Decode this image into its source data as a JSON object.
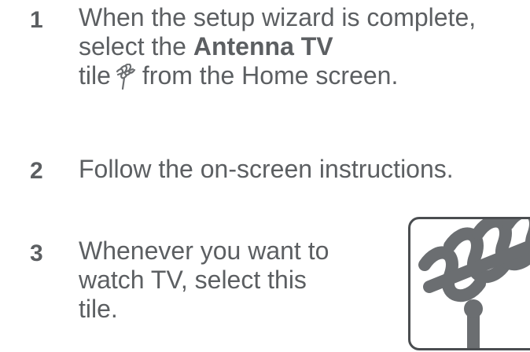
{
  "steps": [
    {
      "number": "1",
      "line1": "When the setup wizard is complete,",
      "line2_prefix": "select the ",
      "line2_bold": "Antenna TV",
      "line3_prefix": "tile",
      "line3_suffix": "from the Home screen."
    },
    {
      "number": "2",
      "line1": "Follow the on-screen instructions."
    },
    {
      "number": "3",
      "line1": "Whenever you want to",
      "line2": "watch TV, select this",
      "line3": "tile."
    }
  ],
  "icons": {
    "inline": "antenna-icon",
    "tile": "antenna-tv-tile"
  },
  "colors": {
    "text": "#5c5f62",
    "icon": "#6b6e71",
    "tile_border": "#4a4d50"
  }
}
